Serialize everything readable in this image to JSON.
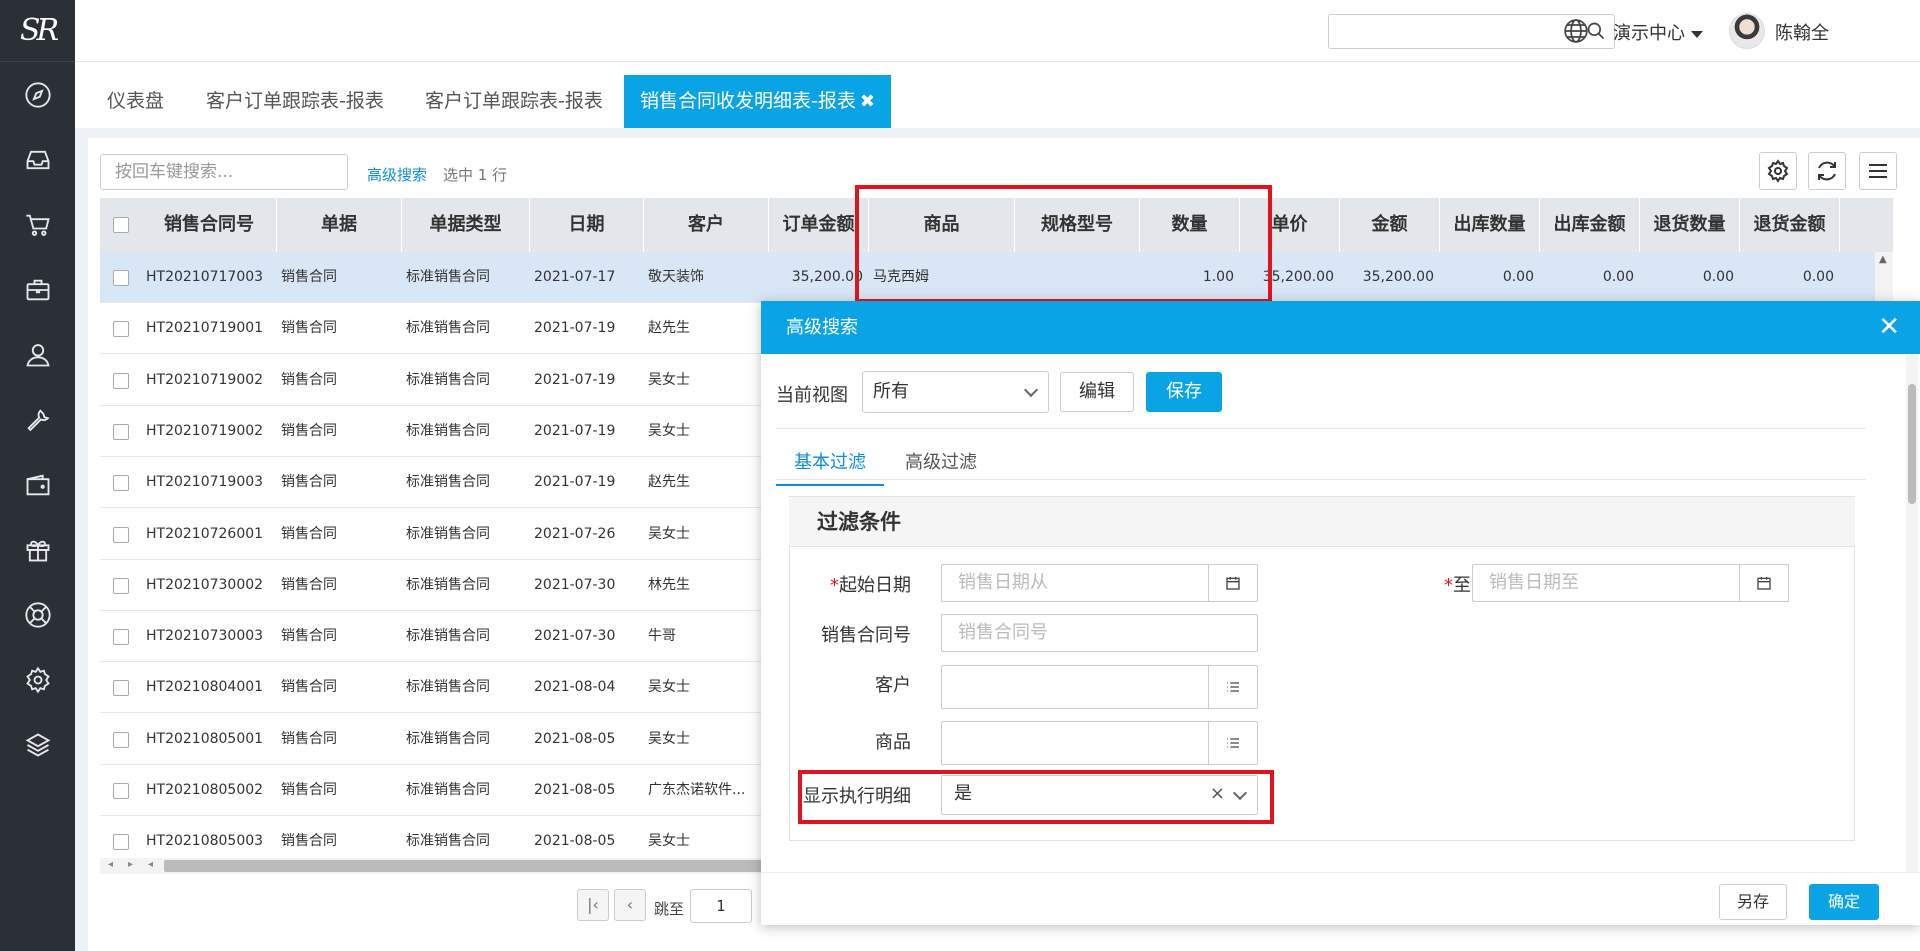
{
  "sidebar": {
    "logo_text": "SR",
    "items": [
      "compass-icon",
      "inbox-icon",
      "cart-icon",
      "briefcase-icon",
      "user-icon",
      "wrench-icon",
      "wallet-icon",
      "gift-icon",
      "lifebuoy-icon",
      "settings-icon",
      "layers-icon"
    ]
  },
  "header": {
    "search_placeholder": "",
    "org_name": "演示中心",
    "user_name": "陈翰全",
    "help_glyph": "?"
  },
  "tabs": [
    {
      "label": "仪表盘",
      "active": false
    },
    {
      "label": "客户订单跟踪表-报表",
      "active": false
    },
    {
      "label": "客户订单跟踪表-报表",
      "active": false
    },
    {
      "label": "销售合同收发明细表-报表",
      "active": true,
      "close": "✖"
    }
  ],
  "toolbar": {
    "search_placeholder": "按回车键搜索...",
    "advanced_search": "高级搜索",
    "selected_info": "选中 1 行"
  },
  "table": {
    "columns": [
      "销售合同号",
      "单据",
      "单据类型",
      "日期",
      "客户",
      "订单金额",
      "商品",
      "规格型号",
      "数量",
      "单价",
      "金额",
      "出库数量",
      "出库金额",
      "退货数量",
      "退货金额"
    ],
    "rows": [
      {
        "selected": true,
        "cells": [
          "HT20210717003",
          "销售合同",
          "标准销售合同",
          "2021-07-17",
          "敬天装饰",
          "35,200.00",
          "马克西姆",
          "",
          "1.00",
          "35,200.00",
          "35,200.00",
          "0.00",
          "0.00",
          "0.00",
          "0.00"
        ]
      },
      {
        "selected": false,
        "cells": [
          "HT20210719001",
          "销售合同",
          "标准销售合同",
          "2021-07-19",
          "赵先生"
        ]
      },
      {
        "selected": false,
        "cells": [
          "HT20210719002",
          "销售合同",
          "标准销售合同",
          "2021-07-19",
          "吴女士"
        ]
      },
      {
        "selected": false,
        "cells": [
          "HT20210719002",
          "销售合同",
          "标准销售合同",
          "2021-07-19",
          "吴女士"
        ]
      },
      {
        "selected": false,
        "cells": [
          "HT20210719003",
          "销售合同",
          "标准销售合同",
          "2021-07-19",
          "赵先生"
        ]
      },
      {
        "selected": false,
        "cells": [
          "HT20210726001",
          "销售合同",
          "标准销售合同",
          "2021-07-26",
          "吴女士"
        ]
      },
      {
        "selected": false,
        "cells": [
          "HT20210730002",
          "销售合同",
          "标准销售合同",
          "2021-07-30",
          "林先生"
        ]
      },
      {
        "selected": false,
        "cells": [
          "HT20210730003",
          "销售合同",
          "标准销售合同",
          "2021-07-30",
          "牛哥"
        ]
      },
      {
        "selected": false,
        "cells": [
          "HT20210804001",
          "销售合同",
          "标准销售合同",
          "2021-08-04",
          "吴女士"
        ]
      },
      {
        "selected": false,
        "cells": [
          "HT20210805001",
          "销售合同",
          "标准销售合同",
          "2021-08-05",
          "吴女士"
        ]
      },
      {
        "selected": false,
        "cells": [
          "HT20210805002",
          "销售合同",
          "标准销售合同",
          "2021-08-05",
          "广东杰诺软件..."
        ]
      },
      {
        "selected": false,
        "cells": [
          "HT20210805003",
          "销售合同",
          "标准销售合同",
          "2021-08-05",
          "吴女士"
        ]
      }
    ]
  },
  "pager": {
    "first": "|‹",
    "prev": "‹",
    "jump_label": "跳至",
    "page_value": "1"
  },
  "modal": {
    "title": "高级搜索",
    "close": "✕",
    "view_label": "当前视图",
    "view_value": "所有",
    "edit_button": "编辑",
    "save_button": "保存",
    "tabs": [
      "基本过滤",
      "高级过滤"
    ],
    "filter_title": "过滤条件",
    "fields": {
      "start_date_label": "起始日期",
      "start_date_placeholder": "销售日期从",
      "end_date_label": "至",
      "end_date_placeholder": "销售日期至",
      "contract_label": "销售合同号",
      "contract_placeholder": "销售合同号",
      "customer_label": "客户",
      "product_label": "商品",
      "show_detail_label": "显示执行明细",
      "show_detail_value": "是",
      "clear_glyph": "×"
    },
    "footer": {
      "save_as": "另存",
      "confirm": "确定"
    }
  },
  "colors": {
    "accent": "#0aa4e6",
    "sidebar_bg": "#2b3036",
    "annotation_red": "#e0141e",
    "selected_row": "#d8e6f5"
  }
}
